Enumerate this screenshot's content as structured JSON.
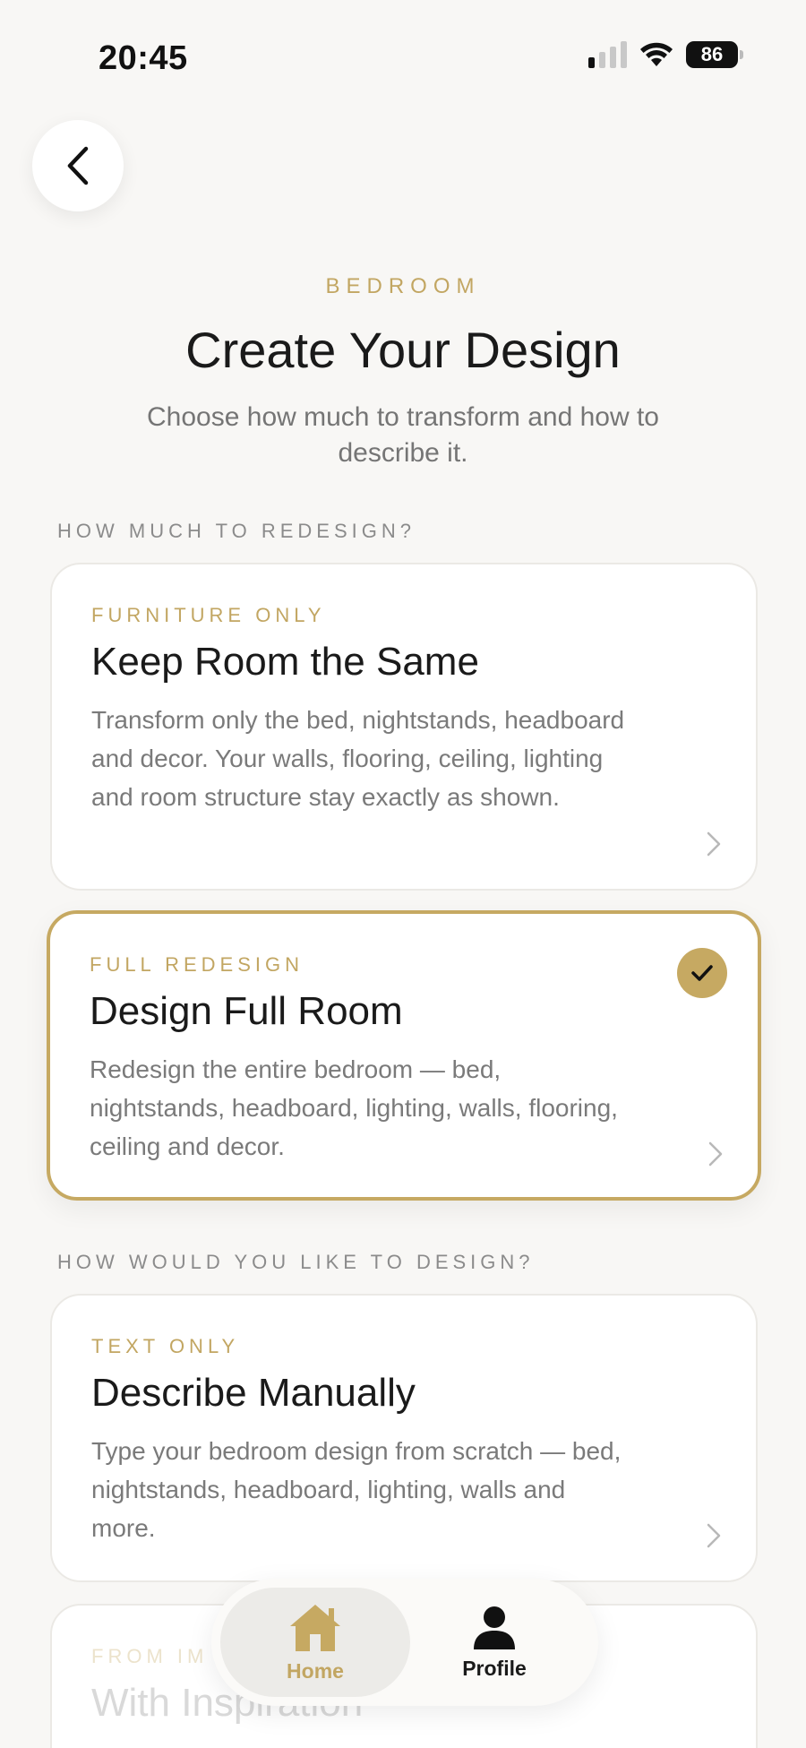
{
  "status_bar": {
    "time": "20:45",
    "battery": "86",
    "signal_bars_on": 1,
    "signal_bars_total": 4
  },
  "header": {
    "eyebrow": "BEDROOM",
    "title": "Create Your Design",
    "subtitle": "Choose how much to transform and how to describe it."
  },
  "sections": {
    "redesign_label": "HOW MUCH TO REDESIGN?",
    "method_label": "HOW WOULD YOU LIKE TO DESIGN?"
  },
  "redesign_options": [
    {
      "eyebrow": "FURNITURE ONLY",
      "title": "Keep Room the Same",
      "description": "Transform only the bed, nightstands, headboard and decor. Your walls, flooring, ceiling, lighting and room structure stay exactly as shown.",
      "selected": false
    },
    {
      "eyebrow": "FULL REDESIGN",
      "title": "Design Full Room",
      "description": "Redesign the entire bedroom — bed, nightstands, headboard, lighting, walls, flooring, ceiling and decor.",
      "selected": true
    }
  ],
  "method_options": [
    {
      "eyebrow": "TEXT ONLY",
      "title": "Describe Manually",
      "description": "Type your bedroom design from scratch — bed, nightstands, headboard, lighting, walls and more."
    },
    {
      "eyebrow": "FROM IM",
      "title": "With Inspiration"
    }
  ],
  "bottom_nav": {
    "home_label": "Home",
    "profile_label": "Profile",
    "active": "Home"
  },
  "colors": {
    "accent_gold": "#c6a962",
    "background": "#f8f7f5",
    "text_primary": "#1a1a1a",
    "text_secondary": "#7a7a7a"
  },
  "icons": [
    "chevron-left-icon",
    "wifi-icon",
    "signal-icon",
    "battery-icon",
    "chevron-right-icon",
    "checkmark-icon",
    "home-icon",
    "person-icon"
  ]
}
